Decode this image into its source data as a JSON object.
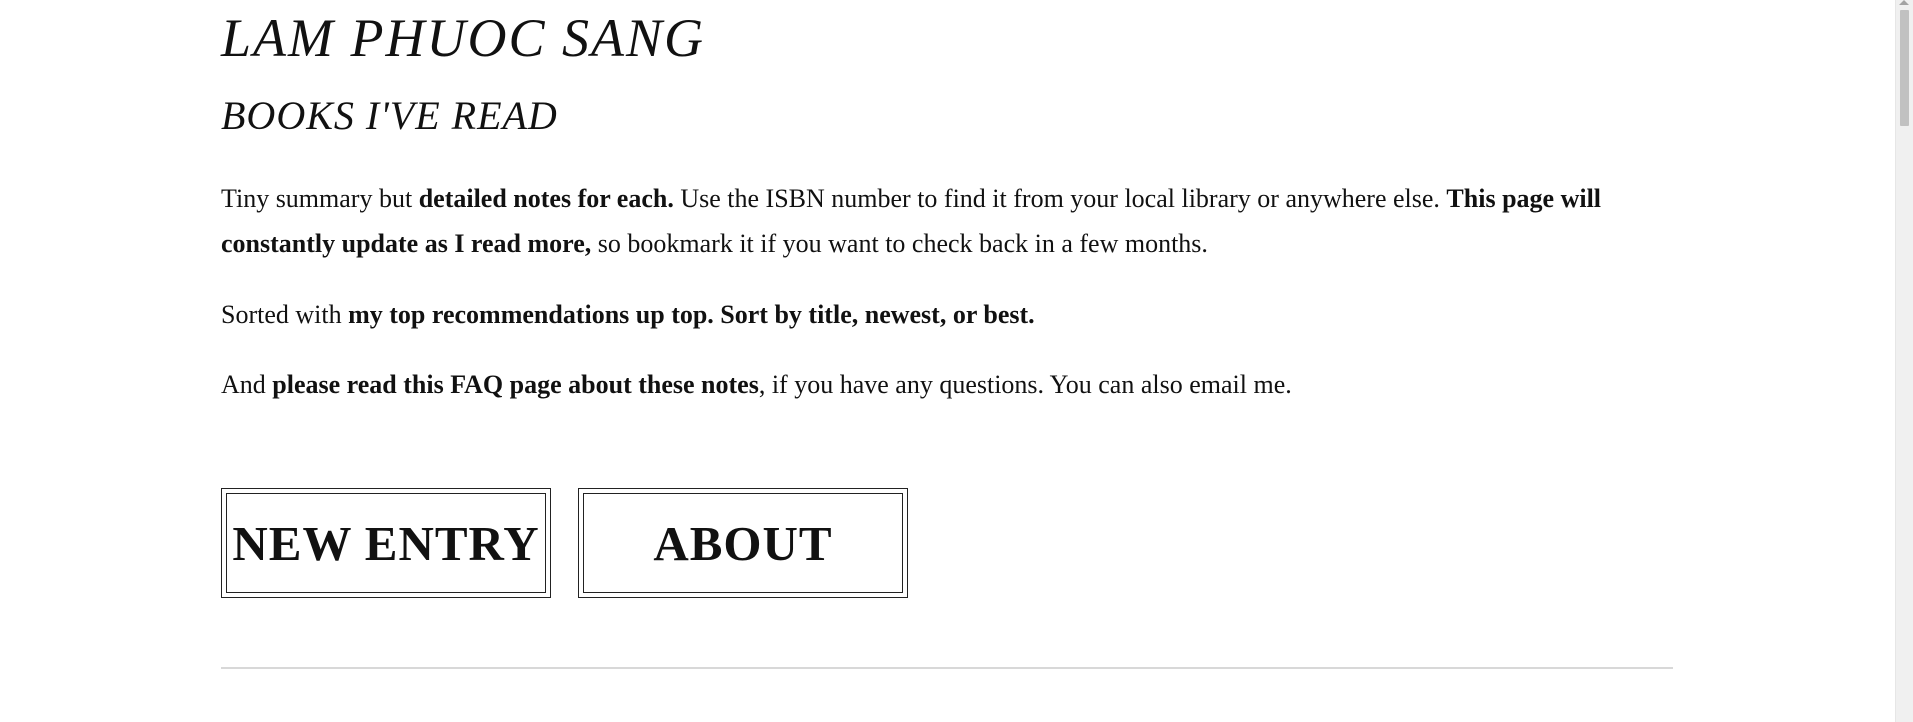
{
  "header": {
    "site_title": "LAM PHUOC SANG",
    "page_title": "BOOKS I'VE READ"
  },
  "intro": {
    "p1": [
      {
        "text": "Tiny summary but ",
        "bold": false
      },
      {
        "text": "detailed notes for each.",
        "bold": true
      },
      {
        "text": " Use the ISBN number to find it from your local library or anywhere else. ",
        "bold": false
      },
      {
        "text": "This page will constantly update as I read more,",
        "bold": true
      },
      {
        "text": " so bookmark it if you want to check back in a few months.",
        "bold": false
      }
    ],
    "p2": [
      {
        "text": "Sorted with ",
        "bold": false
      },
      {
        "text": "my top recommendations up top. Sort by title, newest, or best.",
        "bold": true
      }
    ],
    "p3": [
      {
        "text": "And ",
        "bold": false
      },
      {
        "text": "please read this FAQ page about these notes",
        "bold": true
      },
      {
        "text": ", if you have any questions. You can also email me.",
        "bold": false
      }
    ]
  },
  "buttons": {
    "new_entry_label": "NEW ENTRY",
    "about_label": "ABOUT"
  },
  "colors": {
    "background": "#ffffff",
    "text": "#111111",
    "divider": "#d8d8d8",
    "scrollbar_thumb": "#c1c1c1"
  }
}
